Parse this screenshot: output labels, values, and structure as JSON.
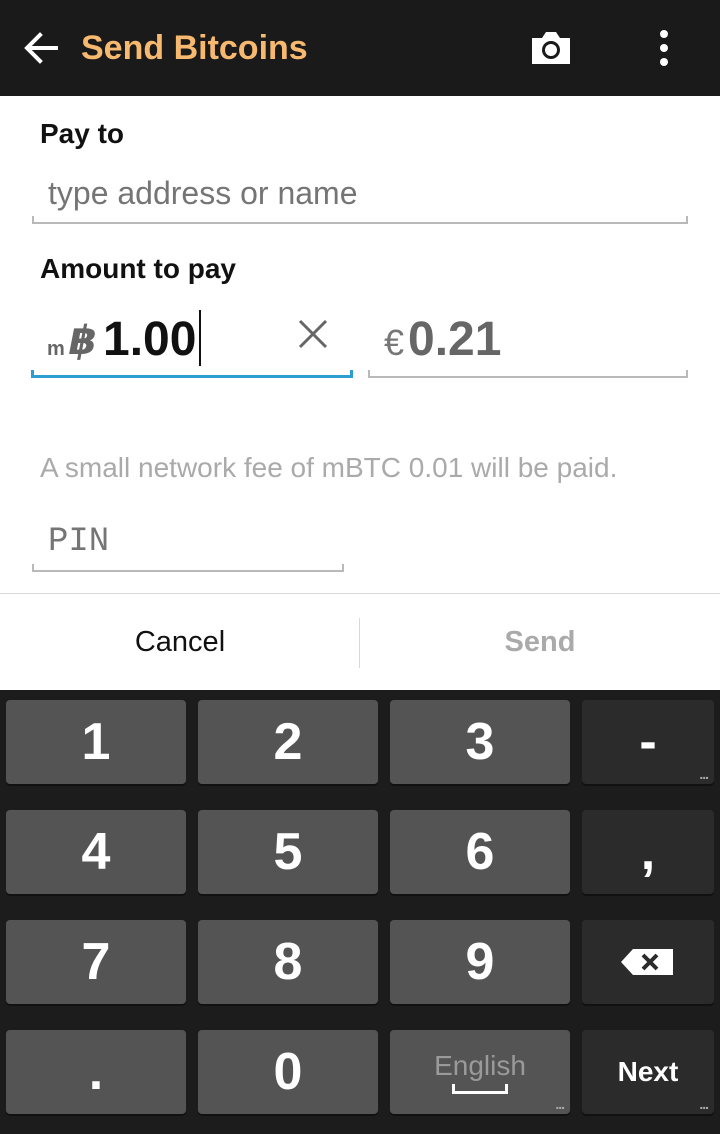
{
  "actionbar": {
    "title": "Send Bitcoins",
    "back_icon": "arrow-left-icon",
    "camera_icon": "camera-icon",
    "overflow_icon": "overflow-menu-icon"
  },
  "form": {
    "pay_to_label": "Pay to",
    "address_placeholder": "type address or name",
    "amount_label": "Amount to pay",
    "btc_unit_prefix": "m",
    "btc_symbol": "฿",
    "btc_amount": "1.00",
    "fiat_symbol": "€",
    "fiat_amount": "0.21",
    "fee_text": "A small network fee of mBTC 0.01 will be paid.",
    "pin_placeholder": "PIN"
  },
  "buttons": {
    "cancel_label": "Cancel",
    "send_label": "Send"
  },
  "keyboard": {
    "rows": [
      [
        "1",
        "2",
        "3",
        "-"
      ],
      [
        "4",
        "5",
        "6",
        ","
      ],
      [
        "7",
        "8",
        "9",
        "⌫"
      ],
      [
        ".",
        "0",
        "English",
        "Next"
      ]
    ],
    "more_indicator": "..."
  },
  "colors": {
    "title": "#f7b96f",
    "focus_underline": "#2b9fd1"
  }
}
